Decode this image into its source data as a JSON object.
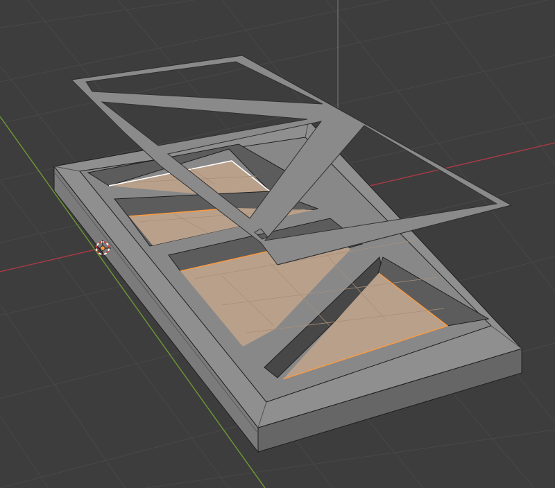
{
  "viewport": {
    "background_color": "#3d3d3d",
    "grid_color": "#484848",
    "x_axis_color": "#a83a44",
    "y_axis_color": "#6d9a33",
    "z_axis_color": "#7a7a7a"
  },
  "model": {
    "top_color": "#8f8f8f",
    "front_color": "#7b7b7b",
    "side_color": "#666666",
    "inner_wall_color": "#5c5c5c",
    "selected_face_color": "#b9a08a",
    "selected_edge_color": "#ff9a3c",
    "active_edge_color": "#ffffff",
    "edge_color": "#1e1e1e"
  },
  "floating_frame": {
    "color": "#8a8a8a"
  },
  "cursor_3d": {
    "name": "3d-cursor",
    "ring_color_a": "#d83a3a",
    "ring_color_b": "#ffffff",
    "center_color": "#ff9a3c"
  }
}
